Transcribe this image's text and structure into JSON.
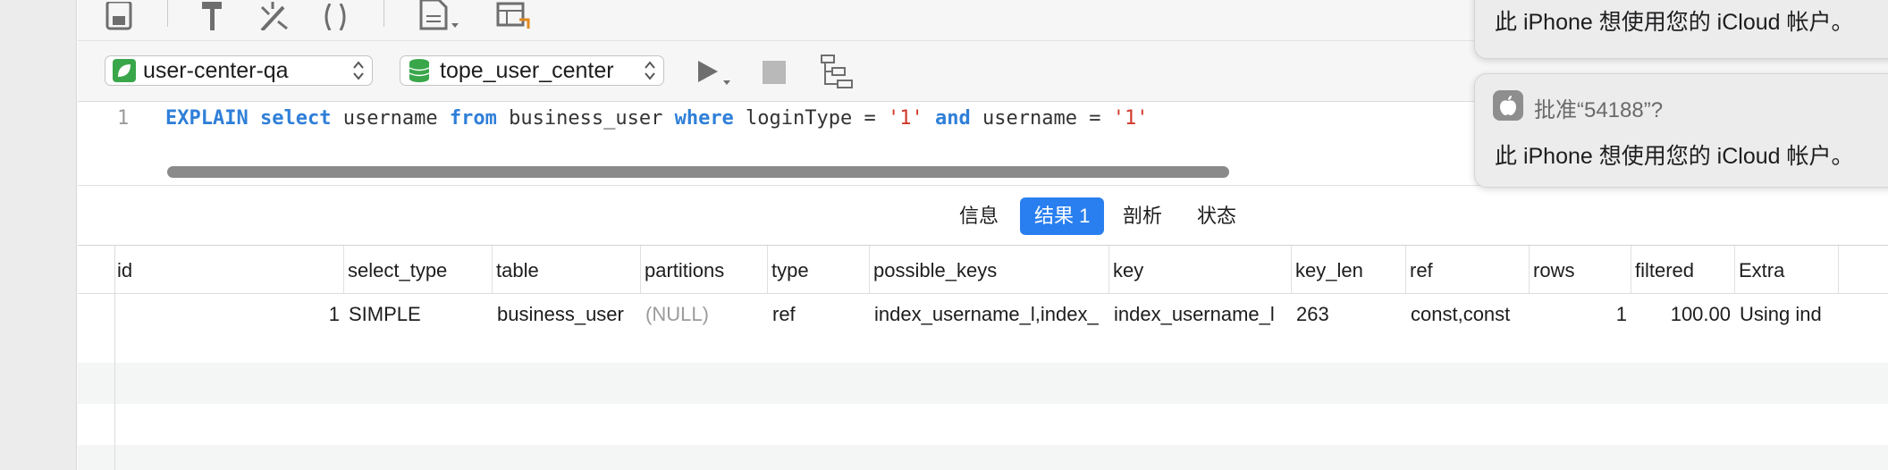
{
  "connection": {
    "name": "user-center-qa",
    "icon": "leaf-icon"
  },
  "database": {
    "name": "tope_user_center",
    "icon": "database-icon"
  },
  "editor": {
    "line_number": "1",
    "tokens": [
      {
        "text": "EXPLAIN",
        "kind": "kw"
      },
      {
        "text": " ",
        "kind": "plain"
      },
      {
        "text": "select",
        "kind": "kw"
      },
      {
        "text": " username ",
        "kind": "plain"
      },
      {
        "text": "from",
        "kind": "kw"
      },
      {
        "text": " business_user ",
        "kind": "plain"
      },
      {
        "text": "where",
        "kind": "kw"
      },
      {
        "text": " loginType = ",
        "kind": "plain"
      },
      {
        "text": "'1'",
        "kind": "str"
      },
      {
        "text": " ",
        "kind": "plain"
      },
      {
        "text": "and",
        "kind": "kw"
      },
      {
        "text": " username = ",
        "kind": "plain"
      },
      {
        "text": "'1'",
        "kind": "str"
      }
    ]
  },
  "tabs": [
    {
      "label": "信息",
      "active": false
    },
    {
      "label": "结果 1",
      "active": true
    },
    {
      "label": "剖析",
      "active": false
    },
    {
      "label": "状态",
      "active": false
    }
  ],
  "grid": {
    "columns": [
      "id",
      "select_type",
      "table",
      "partitions",
      "type",
      "possible_keys",
      "key",
      "key_len",
      "ref",
      "rows",
      "filtered",
      "Extra"
    ],
    "rows": [
      {
        "id": "1",
        "select_type": "SIMPLE",
        "table": "business_user",
        "partitions": "(NULL)",
        "type": "ref",
        "possible_keys": "index_username_l,index_",
        "key": "index_username_l",
        "key_len": "263",
        "ref": "const,const",
        "rows": "1",
        "filtered": "100.00",
        "Extra": "Using ind"
      }
    ]
  },
  "notifications": [
    {
      "title": "",
      "body": "此 iPhone 想使用您的 iCloud 帐户。"
    },
    {
      "title": "批准“54188”?",
      "body": "此 iPhone 想使用您的 iCloud 帐户。",
      "icon": "apple-icon"
    }
  ],
  "colors": {
    "accent": "#2a7ff0",
    "keyword": "#2f7fd8",
    "string": "#d0382a",
    "null_text": "#9b9b9b"
  }
}
